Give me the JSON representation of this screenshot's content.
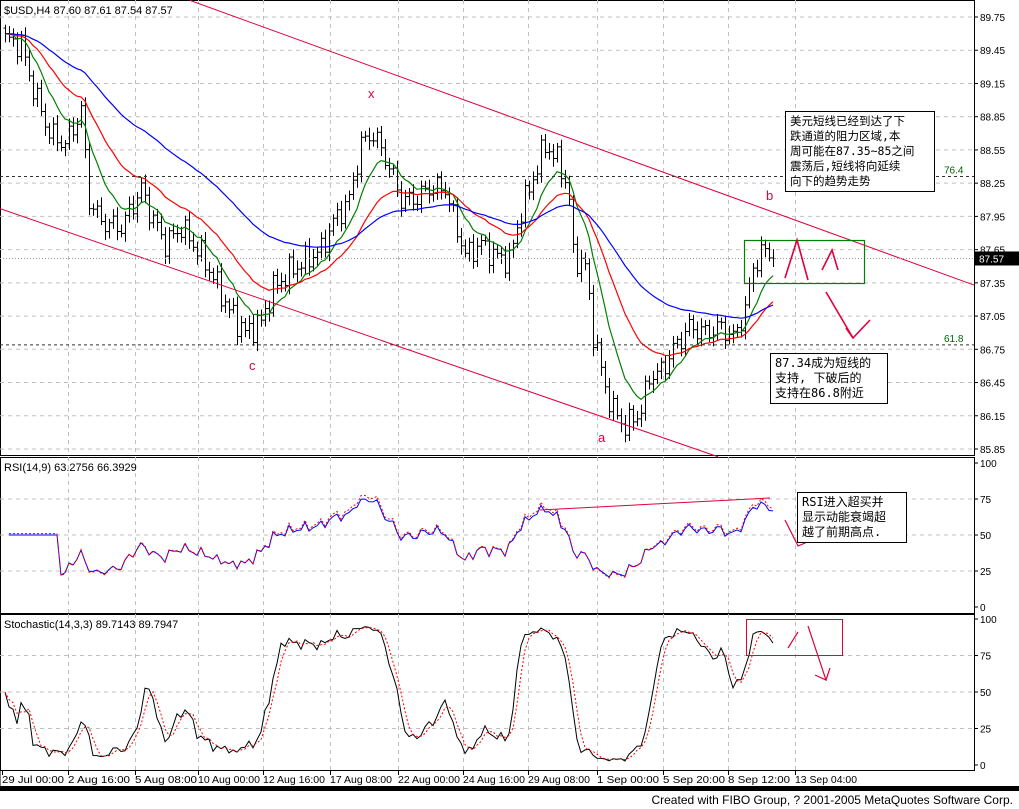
{
  "header": {
    "price_title": "$USD,H4  87.60 87.61 87.54 87.57",
    "rsi_title": "RSI(14,9)  63.2756  66.3929",
    "stoch_title": "Stochastic(14,3,3)  89.7143  89.7947"
  },
  "annotations": {
    "resistance_note": "美元短线已经到达了下\n跌通道的阻力区域,本\n周可能在87.35~85之间\n震荡后,短线将向延续\n向下的趋势走势",
    "support_note": "87.34成为短线的\n支持, 下破后的\n支持在86.8附近",
    "rsi_note": "RSI进入超买并\n显示动能衰竭超\n越了前期高点.",
    "point_labels": [
      "x",
      "c",
      "a",
      "b"
    ],
    "fib_labels": [
      "76.4",
      "61.8"
    ]
  },
  "footer": "Created with FIBO Group, ? 2001-2005 MetaQuotes Software Corp.",
  "colors": {
    "channel": "#e0003c",
    "ma_fast": "#008000",
    "ma_mid": "#ff0000",
    "ma_slow": "#0000ff",
    "fib": "#006400",
    "rsi": "#0000ff",
    "signal": "#ff0000"
  },
  "chart_data": [
    {
      "type": "ohlc",
      "title": "$USD,H4",
      "last": {
        "open": 87.6,
        "high": 87.61,
        "low": 87.54,
        "close": 87.57
      },
      "y_ticks": [
        "89.75",
        "89.45",
        "89.15",
        "88.85",
        "88.55",
        "88.25",
        "87.95",
        "87.65",
        "87.35",
        "87.05",
        "86.75",
        "86.45",
        "86.15",
        "85.85"
      ],
      "ylim": [
        85.85,
        89.75
      ],
      "x_ticks": [
        "29 Jul 00:00",
        "2 Aug 16:00",
        "5 Aug 08:00",
        "10 Aug 00:00",
        "12 Aug 16:00",
        "17 Aug 08:00",
        "22 Aug 00:00",
        "24 Aug 16:00",
        "29 Aug 08:00",
        "1 Sep 00:00",
        "5 Sep 20:00",
        "8 Sep 12:00",
        "13 Sep 04:00"
      ],
      "close_path": [
        [
          0,
          89.55
        ],
        [
          4,
          89.5
        ],
        [
          7,
          89.1
        ],
        [
          11,
          88.7
        ],
        [
          15,
          88.6
        ],
        [
          19,
          88.9
        ],
        [
          21,
          88.1
        ],
        [
          24,
          87.9
        ],
        [
          29,
          87.85
        ],
        [
          34,
          88.2
        ],
        [
          36,
          88.0
        ],
        [
          40,
          87.7
        ],
        [
          44,
          87.85
        ],
        [
          49,
          87.6
        ],
        [
          52,
          87.4
        ],
        [
          56,
          87.1
        ],
        [
          60,
          86.9
        ],
        [
          64,
          87.0
        ],
        [
          67,
          87.3
        ],
        [
          71,
          87.45
        ],
        [
          75,
          87.55
        ],
        [
          79,
          87.65
        ],
        [
          82,
          87.9
        ],
        [
          86,
          88.1
        ],
        [
          89,
          88.6
        ],
        [
          92,
          88.7
        ],
        [
          96,
          88.4
        ],
        [
          99,
          88.1
        ],
        [
          102,
          88.1
        ],
        [
          106,
          88.2
        ],
        [
          110,
          88.2
        ],
        [
          112,
          87.95
        ],
        [
          115,
          87.6
        ],
        [
          119,
          87.7
        ],
        [
          122,
          87.6
        ],
        [
          126,
          87.55
        ],
        [
          129,
          88.0
        ],
        [
          132,
          88.3
        ],
        [
          135,
          88.6
        ],
        [
          139,
          88.4
        ],
        [
          141,
          88.1
        ],
        [
          142,
          87.6
        ],
        [
          145,
          87.5
        ],
        [
          147,
          86.9
        ],
        [
          150,
          86.4
        ],
        [
          152,
          86.2
        ],
        [
          155,
          86.05
        ],
        [
          159,
          86.2
        ],
        [
          161,
          86.5
        ],
        [
          164,
          86.55
        ],
        [
          167,
          86.75
        ],
        [
          171,
          86.95
        ],
        [
          175,
          86.9
        ],
        [
          179,
          86.95
        ],
        [
          182,
          86.85
        ],
        [
          185,
          87.1
        ],
        [
          187,
          87.5
        ],
        [
          190,
          87.65
        ],
        [
          192,
          87.57
        ]
      ],
      "moving_averages": [
        {
          "name": "fast",
          "period": 10
        },
        {
          "name": "mid",
          "period": 24
        },
        {
          "name": "slow",
          "period": 55
        }
      ],
      "channel": {
        "upper": [
          [
            46.25,
            89.9
          ],
          [
            242.25,
            87.33
          ]
        ],
        "lower": [
          [
            -1.25,
            88.02
          ],
          [
            178.25,
            85.78
          ]
        ]
      },
      "fib_levels": [
        {
          "label": "76.4",
          "price": 88.31
        },
        {
          "label": "61.8",
          "price": 86.79
        }
      ],
      "current_price": "87.57"
    },
    {
      "type": "line",
      "title": "RSI(14,9)",
      "values": [
        63.2756,
        66.3929
      ],
      "y_ticks": [
        "100",
        "75",
        "50",
        "25",
        "0"
      ],
      "ylim": [
        0,
        100
      ]
    },
    {
      "type": "line",
      "title": "Stochastic(14,3,3)",
      "values": [
        89.7143,
        89.7947
      ],
      "y_ticks": [
        "100",
        "75",
        "50",
        "25",
        "0"
      ],
      "ylim": [
        0,
        100
      ]
    }
  ]
}
